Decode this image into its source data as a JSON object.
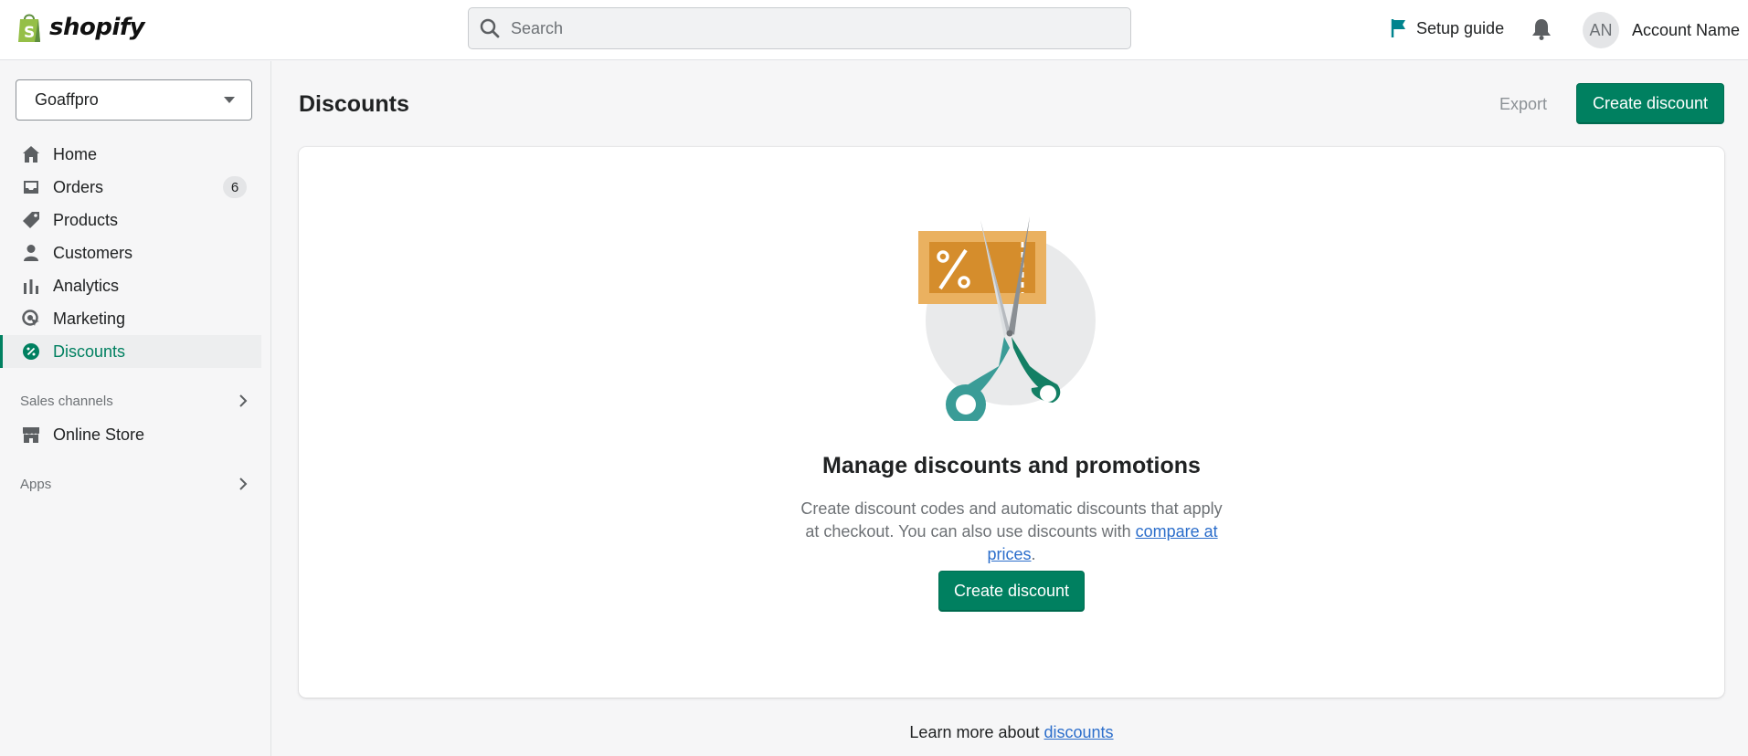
{
  "topbar": {
    "logo_text": "shopify",
    "search_placeholder": "Search",
    "setup_guide": "Setup guide",
    "account_initials": "AN",
    "account_name": "Account Name"
  },
  "sidebar": {
    "store_name": "Goaffpro",
    "items": [
      {
        "label": "Home",
        "icon": "home-icon"
      },
      {
        "label": "Orders",
        "icon": "inbox-icon",
        "badge": "6"
      },
      {
        "label": "Products",
        "icon": "tag-icon"
      },
      {
        "label": "Customers",
        "icon": "person-icon"
      },
      {
        "label": "Analytics",
        "icon": "bar-chart-icon"
      },
      {
        "label": "Marketing",
        "icon": "target-icon"
      },
      {
        "label": "Discounts",
        "icon": "discount-icon",
        "active": true
      }
    ],
    "sales_channels": "Sales channels",
    "online_store": "Online Store",
    "apps": "Apps"
  },
  "main": {
    "title": "Discounts",
    "export_label": "Export",
    "create_label": "Create discount",
    "empty": {
      "title": "Manage discounts and promotions",
      "desc_part1": "Create discount codes and automatic discounts that apply at checkout. You can also use discounts with ",
      "desc_link": "compare at prices",
      "desc_end": ".",
      "button": "Create discount"
    },
    "learn_more": "Learn more about ",
    "learn_link": "discounts"
  },
  "colors": {
    "primary": "#008060",
    "link": "#2c6ecb",
    "setup_flag": "#00848e"
  }
}
